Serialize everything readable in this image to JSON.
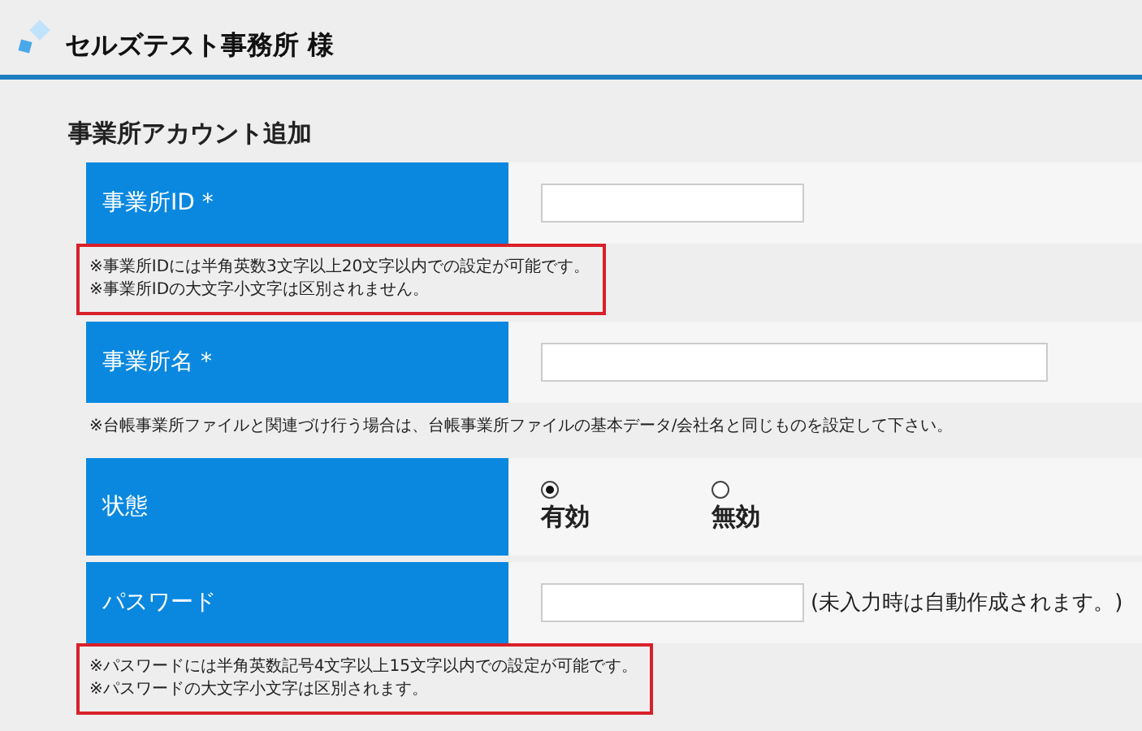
{
  "header": {
    "title": "セルズテスト事務所 様"
  },
  "page_title": "事業所アカウント追加",
  "rows": [
    {
      "kind": "short_text",
      "label": "事業所ID *",
      "note": {
        "lines": [
          "※事業所IDには半角英数3文字以上20文字以内での設定が可能です。",
          "※事業所IDの大文字小文字は区別されません。"
        ],
        "highlighted": true
      }
    },
    {
      "kind": "long_text",
      "label": "事業所名 *",
      "note": {
        "lines": [
          "※台帳事業所ファイルと関連づけ行う場合は、台帳事業所ファイルの基本データ/会社名と同じものを設定して下さい。"
        ],
        "highlighted": false
      }
    },
    {
      "kind": "radio",
      "label": "状態",
      "options": [
        {
          "label": "有効",
          "selected": true
        },
        {
          "label": "無効",
          "selected": false
        }
      ]
    },
    {
      "kind": "short_text",
      "label": "パスワード",
      "hint": "(未入力時は自動作成されます。)",
      "note": {
        "lines": [
          "※パスワードには半角英数記号4文字以上15文字以内での設定が可能です。",
          "※パスワードの大文字小文字は区別されます。"
        ],
        "highlighted": true
      }
    }
  ]
}
